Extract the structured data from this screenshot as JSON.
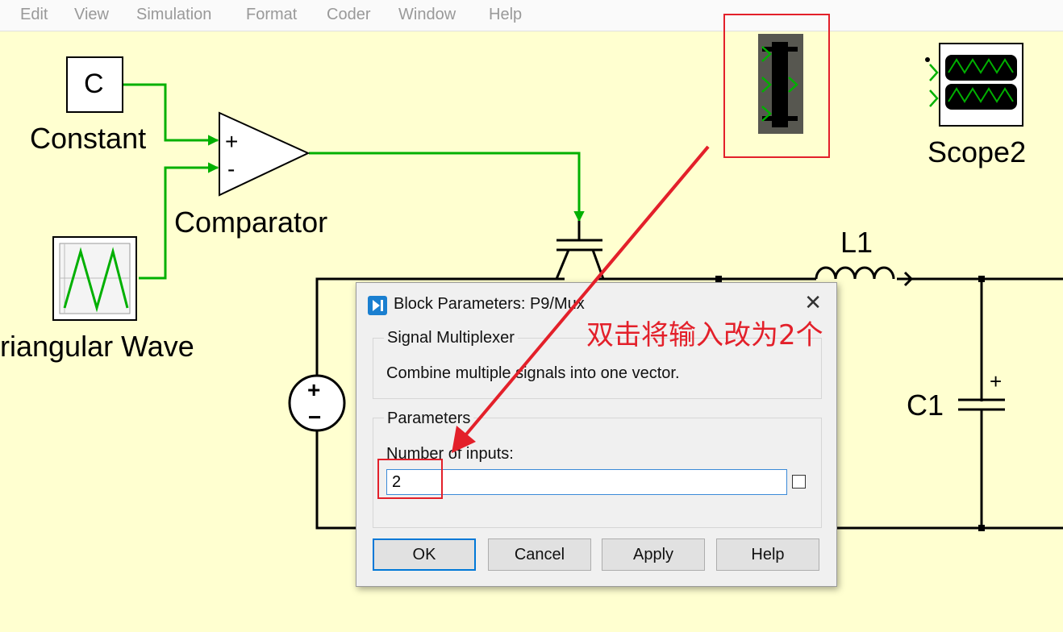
{
  "menu": [
    "Edit",
    "View",
    "Simulation",
    "Format",
    "Coder",
    "Window",
    "Help"
  ],
  "blocks": {
    "constant_symbol": "C",
    "constant_name": "Constant",
    "comparator_name": "Comparator",
    "comparator_plus": "+",
    "comparator_minus": "-",
    "triangular_name": "riangular Wave",
    "scope_name": "Scope2",
    "inductor_name": "L1",
    "capacitor_name": "C1",
    "capacitor_plus": "+",
    "source_plus": "+",
    "source_minus": "−"
  },
  "dialog": {
    "title": "Block Parameters: P9/Mux",
    "close": "✕",
    "group1_title": "Signal Multiplexer",
    "description": "Combine multiple signals into one vector.",
    "group2_title": "Parameters",
    "inputs_label": "Number of inputs:",
    "inputs_value": "2",
    "buttons": {
      "ok": "OK",
      "cancel": "Cancel",
      "apply": "Apply",
      "help": "Help"
    }
  },
  "annotation": {
    "text": "双击将输入改为2个",
    "color": "#e3202a"
  },
  "colors": {
    "canvas_bg": "#ffffd0",
    "signal_green": "#00b000",
    "accent_blue": "#0078d7"
  }
}
